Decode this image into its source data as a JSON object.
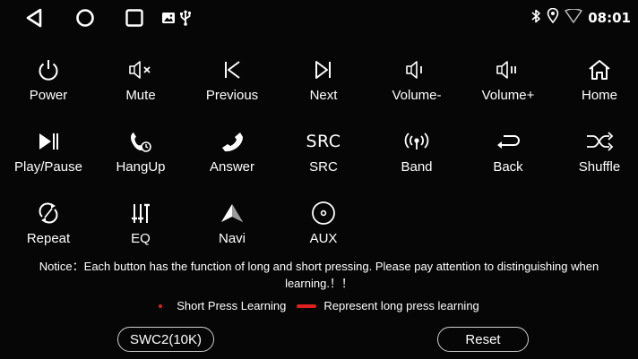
{
  "statusbar": {
    "time": "08:01",
    "icons": [
      "back-triangle-icon",
      "home-circle-icon",
      "recents-square-icon",
      "image-icon",
      "usb-icon",
      "bluetooth-icon",
      "location-icon",
      "wifi-icon"
    ]
  },
  "keys": [
    {
      "label": "Power",
      "icon": "power-icon"
    },
    {
      "label": "Mute",
      "icon": "mute-icon"
    },
    {
      "label": "Previous",
      "icon": "previous-icon"
    },
    {
      "label": "Next",
      "icon": "next-icon"
    },
    {
      "label": "Volume-",
      "icon": "volume-down-icon"
    },
    {
      "label": "Volume+",
      "icon": "volume-up-icon"
    },
    {
      "label": "Home",
      "icon": "home-icon"
    },
    {
      "label": "Play/Pause",
      "icon": "play-pause-icon"
    },
    {
      "label": "HangUp",
      "icon": "hangup-icon"
    },
    {
      "label": "Answer",
      "icon": "answer-icon"
    },
    {
      "label": "SRC",
      "icon": "src-icon",
      "glyph": "SRC"
    },
    {
      "label": "Band",
      "icon": "band-icon"
    },
    {
      "label": "Back",
      "icon": "back-icon"
    },
    {
      "label": "Shuffle",
      "icon": "shuffle-icon"
    },
    {
      "label": "Repeat",
      "icon": "repeat-icon"
    },
    {
      "label": "EQ",
      "icon": "eq-icon"
    },
    {
      "label": "Navi",
      "icon": "navi-icon"
    },
    {
      "label": "AUX",
      "icon": "aux-icon"
    }
  ],
  "notice": "Notice：Each button has the function of long and short pressing. Please pay attention to distinguishing when learning.！！",
  "legend": {
    "short": "Short Press Learning",
    "long": "Represent long press learning",
    "color": "#e02020"
  },
  "buttons": {
    "mode": "SWC2(10K)",
    "reset": "Reset"
  }
}
